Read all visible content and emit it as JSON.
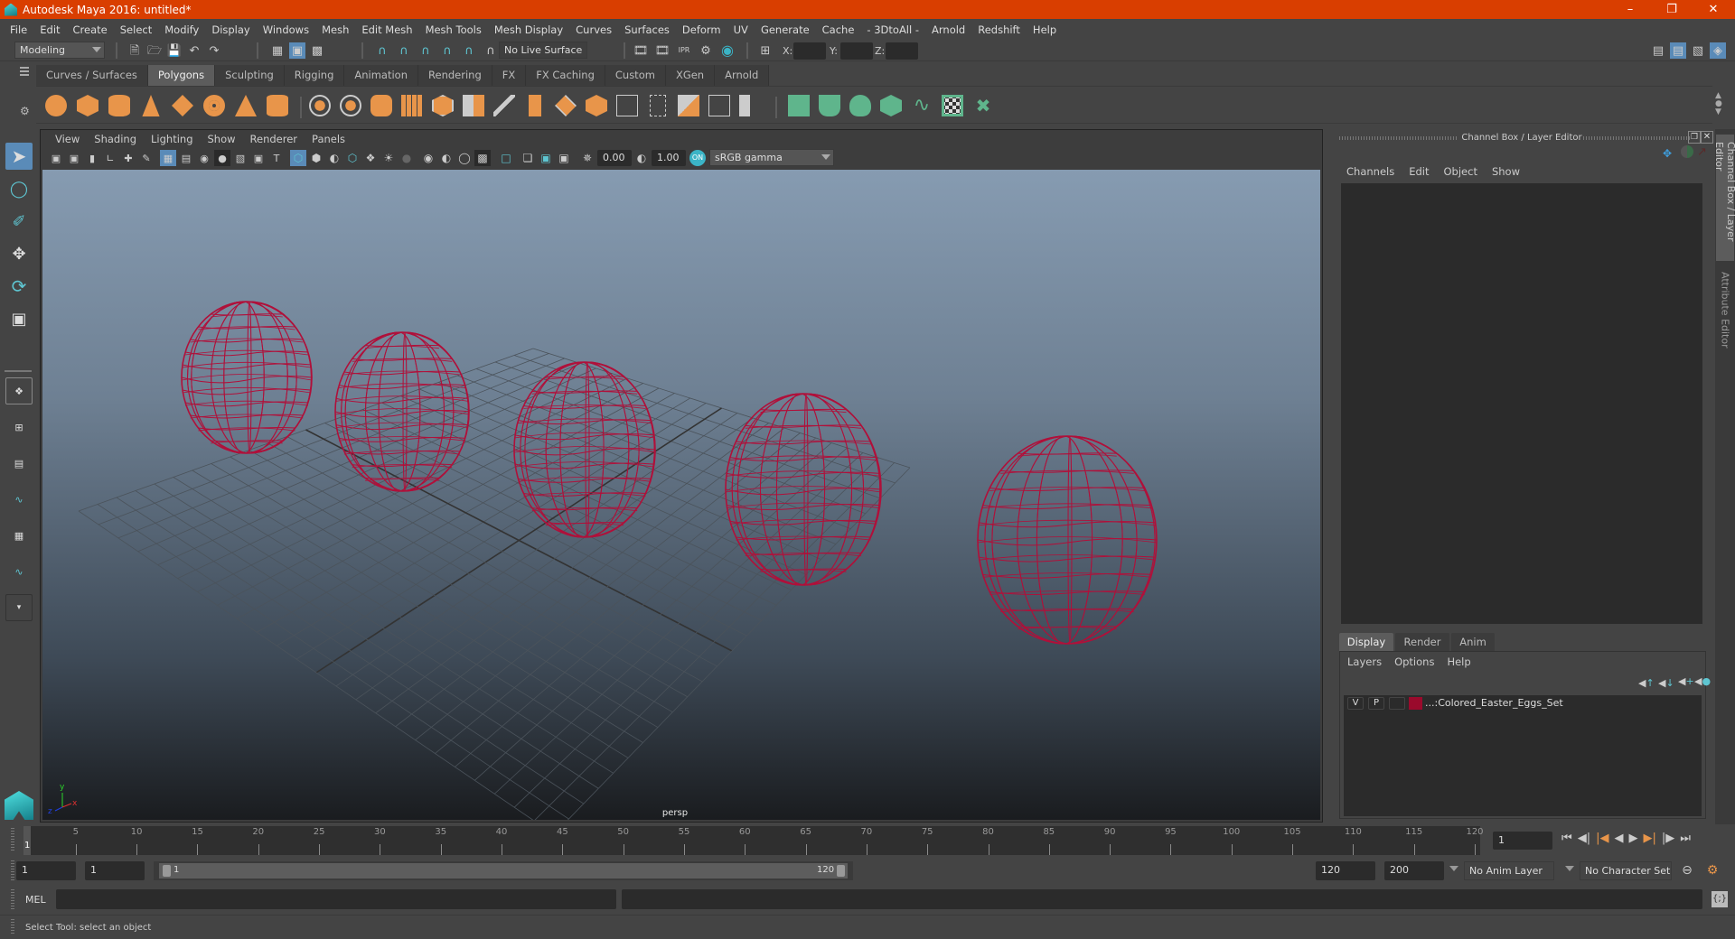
{
  "window": {
    "title": "Autodesk Maya 2016: untitled*",
    "controls": [
      "minimize",
      "restore",
      "close"
    ]
  },
  "menubar": {
    "items": [
      "File",
      "Edit",
      "Create",
      "Select",
      "Modify",
      "Display",
      "Windows",
      "Mesh",
      "Edit Mesh",
      "Mesh Tools",
      "Mesh Display",
      "Curves",
      "Surfaces",
      "Deform",
      "UV",
      "Generate",
      "Cache",
      "- 3DtoAll -",
      "Arnold",
      "Redshift",
      "Help"
    ]
  },
  "statusline": {
    "mode_menu": "Modeling",
    "live_surface": "No Live Surface",
    "x_label": "X:",
    "y_label": "Y:",
    "z_label": "Z:",
    "x_value": "",
    "y_value": "",
    "z_value": ""
  },
  "shelf": {
    "tabs": [
      "Curves / Surfaces",
      "Polygons",
      "Sculpting",
      "Rigging",
      "Animation",
      "Rendering",
      "FX",
      "FX Caching",
      "Custom",
      "XGen",
      "Arnold"
    ],
    "active_tab": "Polygons",
    "poly_primitives": [
      "sphere-icon",
      "cube-icon",
      "cylinder-icon",
      "cone-icon",
      "plane-icon",
      "torus-icon",
      "pyramid-icon",
      "pipe-icon"
    ],
    "mesh_tools": [
      "combine-icon",
      "separate-icon",
      "mirror-icon",
      "smooth-icon",
      "reduce-icon",
      "boolean-icon",
      "bevel-icon",
      "extrude-icon",
      "bridge-icon",
      "fill-hole-icon",
      "multi-cut-icon",
      "target-weld-icon",
      "insert-edge-loop-icon",
      "quad-draw-icon",
      "connect-icon"
    ],
    "uv_tools": [
      "planar-map-icon",
      "cylindrical-map-icon",
      "spherical-map-icon",
      "automatic-map-icon",
      "unfold-icon",
      "uv-editor-icon",
      "sew-uv-icon"
    ]
  },
  "viewport": {
    "menus": [
      "View",
      "Shading",
      "Lighting",
      "Show",
      "Renderer",
      "Panels"
    ],
    "exposure": "0.00",
    "gamma": "1.00",
    "color_space": "sRGB gamma",
    "camera_label": "persp",
    "axis": {
      "x": "x",
      "y": "y",
      "z": "z"
    },
    "wire_color": "#b0103a",
    "egg_count": 5
  },
  "channel_box": {
    "title": "Channel Box / Layer Editor",
    "menus": [
      "Channels",
      "Edit",
      "Object",
      "Show"
    ]
  },
  "layer_editor": {
    "tabs": [
      "Display",
      "Render",
      "Anim"
    ],
    "active_tab": "Display",
    "menus": [
      "Layers",
      "Options",
      "Help"
    ],
    "layers": [
      {
        "visible": "V",
        "playback": "P",
        "type": "",
        "color": "#9a0a2c",
        "name": "...:Colored_Easter_Eggs_Set"
      }
    ]
  },
  "side_tabs": [
    "Channel Box / Layer Editor",
    "Attribute Editor"
  ],
  "timeline": {
    "ticks": [
      5,
      10,
      15,
      20,
      25,
      30,
      35,
      40,
      45,
      50,
      55,
      60,
      65,
      70,
      75,
      80,
      85,
      90,
      95,
      100,
      105,
      110,
      115,
      120
    ],
    "current_marker": "1",
    "current_frame": "1",
    "range_min": 1,
    "range_max": 120
  },
  "range_slider": {
    "start_time": "1",
    "playback_start": "1",
    "slider_start": "1",
    "slider_end": "120",
    "playback_end": "120",
    "end_time": "200",
    "anim_layer": "No Anim Layer",
    "character_set": "No Character Set"
  },
  "command_line": {
    "language": "MEL",
    "input": "",
    "output": ""
  },
  "help_line": {
    "text": "Select Tool: select an object"
  }
}
